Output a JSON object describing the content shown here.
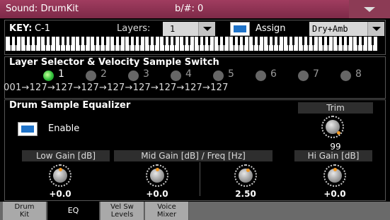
{
  "titlebar": {
    "title": "Sound: DrumKit",
    "key_sig": "b/#: 0",
    "menu_icon": "triangle-down"
  },
  "key_panel": {
    "key_label": "KEY:",
    "key_value": "C-1",
    "layers_label": "Layers:",
    "layers_value": "1",
    "assign_label": "Assign",
    "assign_checked": true,
    "mode_value": "Dry+Amb"
  },
  "layer_selector": {
    "title": "Layer Selector & Velocity Sample Switch",
    "layers": [
      "1",
      "2",
      "3",
      "4",
      "5",
      "6",
      "7",
      "8"
    ],
    "active_layer": "1",
    "velocity_ranges": [
      "001",
      "127",
      "127",
      "127",
      "127",
      "127",
      "127",
      "127",
      "127"
    ],
    "arrow": "→"
  },
  "eq": {
    "title": "Drum Sample Equalizer",
    "trim_label": "Trim",
    "trim_value": "99",
    "enable_label": "Enable",
    "enable_checked": true,
    "low_gain_label": "Low Gain [dB]",
    "mid_label": "Mid Gain [dB] / Freq [Hz]",
    "hi_gain_label": "Hi Gain [dB]",
    "low_gain_value": "+0.0",
    "mid_gain_value": "+0.0",
    "mid_freq_value": "2.50",
    "hi_gain_value": "+0.0"
  },
  "tabs": [
    {
      "label1": "Drum",
      "label2": "Kit"
    },
    {
      "label1": "EQ",
      "label2": ""
    },
    {
      "label1": "Vel Sw",
      "label2": "Levels"
    },
    {
      "label1": "Voice",
      "label2": "Mixer"
    }
  ],
  "active_tab": "EQ",
  "colors": {
    "titlebar": "#8c3b55",
    "led_on": "#2fbf3a",
    "checkbox": "#1f73c9",
    "knob_marker": "#f39a25"
  }
}
